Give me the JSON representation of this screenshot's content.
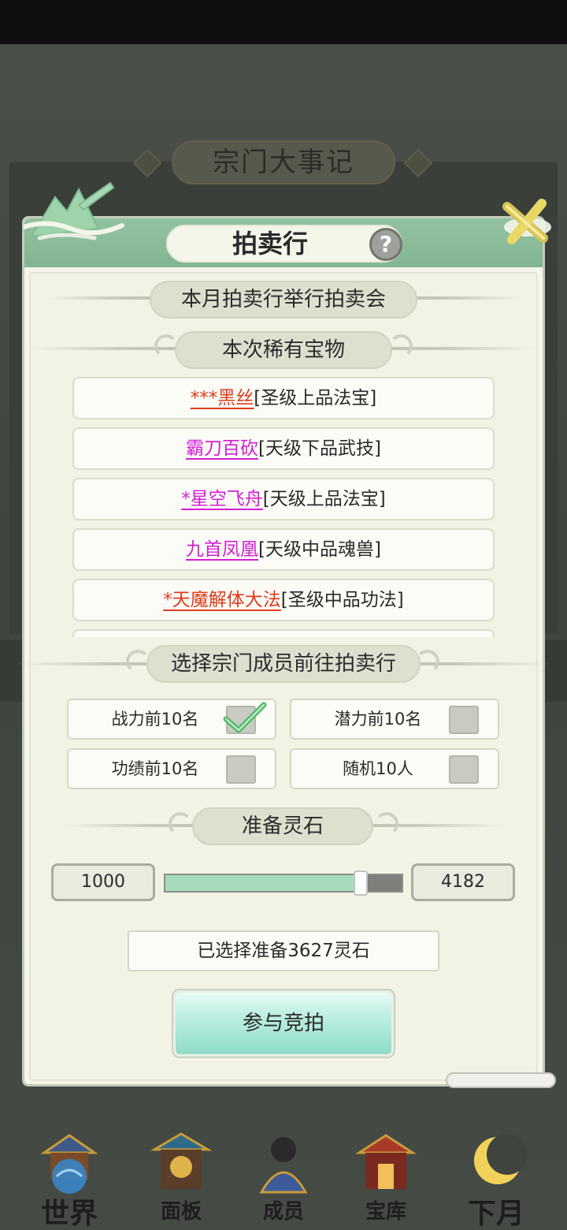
{
  "background": {
    "title": "宗门大事记"
  },
  "dialog": {
    "title": "拍卖行",
    "help_icon": "?",
    "close_icon": "close-x-icon",
    "announcement": "本月拍卖行举行拍卖会",
    "rare_items_heading": "本次稀有宝物",
    "items": [
      {
        "name": "***黑丝",
        "grade": "[圣级上品法宝]",
        "color": "#e23a1e"
      },
      {
        "name": "霸刀百砍",
        "grade": "[天级下品武技]",
        "color": "#d21fd6"
      },
      {
        "name": "*星空飞舟",
        "grade": "[天级上品法宝]",
        "color": "#d21fd6"
      },
      {
        "name": "九首凤凰",
        "grade": "[天级中品魂兽]",
        "color": "#d21fd6"
      },
      {
        "name": "*天魔解体大法",
        "grade": "[圣级中品功法]",
        "color": "#e23a1e"
      }
    ],
    "member_heading": "选择宗门成员前往拍卖行",
    "options": [
      {
        "label": "战力前10名",
        "checked": true
      },
      {
        "label": "潜力前10名",
        "checked": false
      },
      {
        "label": "功绩前10名",
        "checked": false
      },
      {
        "label": "随机10人",
        "checked": false
      }
    ],
    "stones_heading": "准备灵石",
    "slider": {
      "min": "1000",
      "max": "4182",
      "value": 3627
    },
    "selected_text": "已选择准备3627灵石",
    "bid_button": "参与竞拍"
  },
  "bottom_nav": [
    {
      "label": "世界",
      "icon": "world-icon"
    },
    {
      "label": "面板",
      "icon": "panel-icon"
    },
    {
      "label": "成员",
      "icon": "members-icon"
    },
    {
      "label": "宝库",
      "icon": "treasury-icon"
    },
    {
      "label": "下月",
      "icon": "next-month-icon"
    }
  ]
}
